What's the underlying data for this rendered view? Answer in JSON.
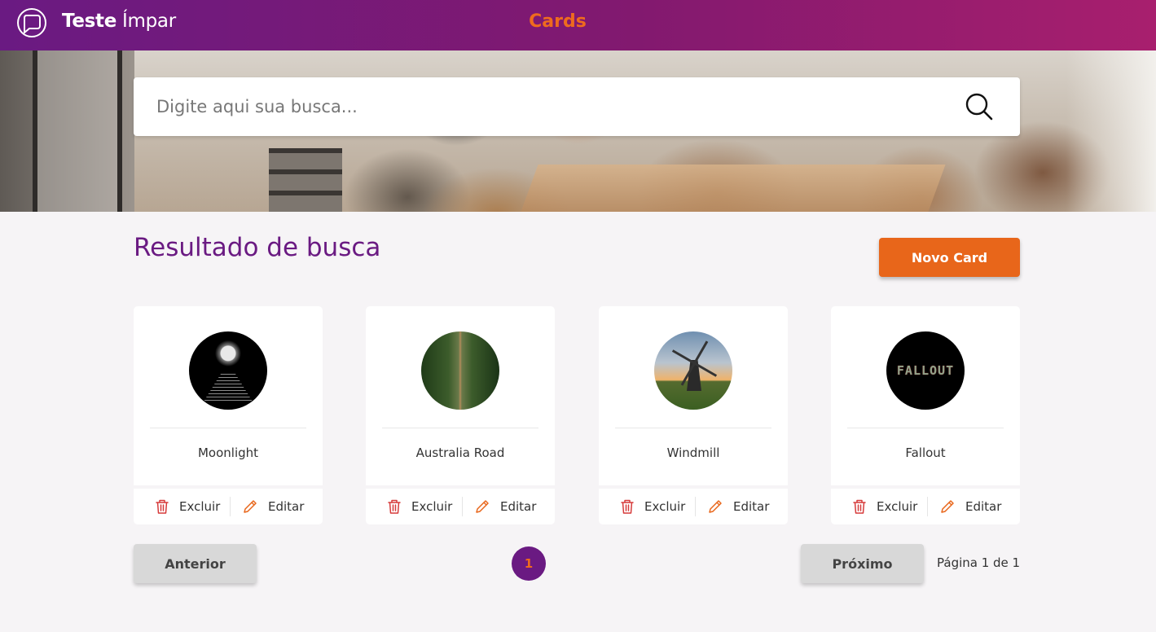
{
  "header": {
    "brand_bold": "Teste",
    "brand_light": "Ímpar",
    "title": "Cards"
  },
  "search": {
    "placeholder": "Digite aqui sua busca...",
    "value": ""
  },
  "results": {
    "title": "Resultado de busca",
    "new_card_label": "Novo Card"
  },
  "cards": [
    {
      "title": "Moonlight",
      "image": "moon-reflection-image",
      "delete_label": "Excluir",
      "edit_label": "Editar"
    },
    {
      "title": "Australia Road",
      "image": "forest-road-image",
      "delete_label": "Excluir",
      "edit_label": "Editar"
    },
    {
      "title": "Windmill",
      "image": "windmill-image",
      "delete_label": "Excluir",
      "edit_label": "Editar"
    },
    {
      "title": "Fallout",
      "image": "fallout-logo-image",
      "delete_label": "Excluir",
      "edit_label": "Editar",
      "image_text": "FALLOUT"
    }
  ],
  "pagination": {
    "prev_label": "Anterior",
    "next_label": "Próximo",
    "current_page": "1",
    "info": "Página 1 de 1"
  },
  "colors": {
    "header_start": "#6a1a82",
    "header_end": "#a81f6e",
    "accent_orange": "#e8661a",
    "purple": "#6a1a82",
    "delete_red": "#d63a3a",
    "edit_orange": "#e8661a"
  }
}
